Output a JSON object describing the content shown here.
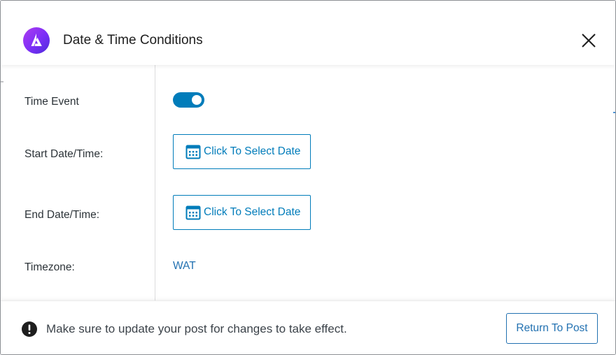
{
  "header": {
    "title": "Date & Time Conditions",
    "logo_icon": "astra-logo-icon",
    "close_icon": "close-icon"
  },
  "fields": {
    "time_event": {
      "label": "Time Event",
      "enabled": true
    },
    "start": {
      "label": "Start Date/Time:",
      "button_label": "Click To Select Date",
      "icon": "calendar-icon"
    },
    "end": {
      "label": "End Date/Time:",
      "button_label": "Click To Select Date",
      "icon": "calendar-icon"
    },
    "timezone": {
      "label": "Timezone:",
      "value": "WAT"
    }
  },
  "footer": {
    "warning_icon": "exclamation-circle-icon",
    "message": "Make sure to update your post for changes to take effect.",
    "return_label": "Return To Post"
  },
  "colors": {
    "accent": "#007cba",
    "link": "#2271b1",
    "logo_gradient_start": "#ad3cf0",
    "logo_gradient_end": "#4c2bd9"
  }
}
